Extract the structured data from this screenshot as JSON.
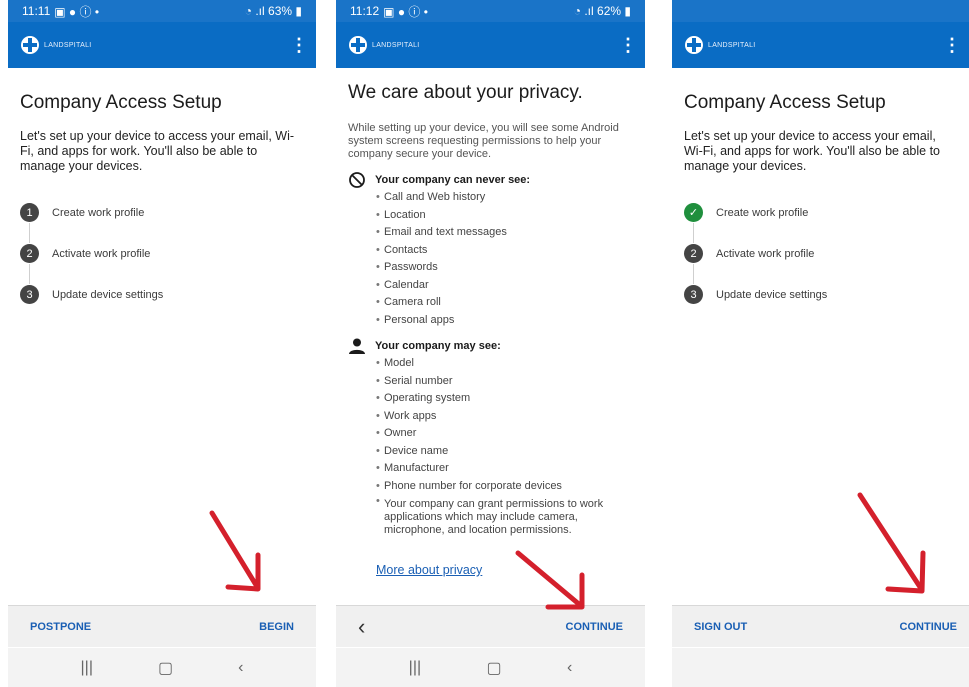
{
  "screens": [
    {
      "status": {
        "time": "11:11",
        "battery": "63%"
      },
      "app": {
        "logo_text": "LANDSPITALI"
      },
      "title": "Company Access Setup",
      "intro": "Let's set up your device to access your email, Wi-Fi, and apps for work. You'll also be able to manage your devices.",
      "steps": [
        {
          "num": "1",
          "label": "Create work profile",
          "done": false
        },
        {
          "num": "2",
          "label": "Activate work profile",
          "done": false
        },
        {
          "num": "3",
          "label": "Update device settings",
          "done": false
        }
      ],
      "footer": {
        "left": "POSTPONE",
        "right": "BEGIN"
      }
    },
    {
      "status": {
        "time": "11:12",
        "battery": "62%"
      },
      "app": {
        "logo_text": "LANDSPITALI"
      },
      "title": "We care about your privacy.",
      "intro": "While setting up your device, you will see some Android system screens requesting permissions to help your company secure your device.",
      "never_see": {
        "heading": "Your company can never see:",
        "items": [
          "Call and Web history",
          "Location",
          "Email and text messages",
          "Contacts",
          "Passwords",
          "Calendar",
          "Camera roll",
          "Personal apps"
        ]
      },
      "may_see": {
        "heading": "Your company may see:",
        "items": [
          "Model",
          "Serial number",
          "Operating system",
          "Work apps",
          "Owner",
          "Device name",
          "Manufacturer",
          "Phone number for corporate devices"
        ],
        "last_item": "Your company can grant permissions to work applications which may include camera, microphone, and location permissions."
      },
      "link": "More about privacy",
      "footer": {
        "back": "‹",
        "right": "CONTINUE"
      }
    },
    {
      "app": {
        "logo_text": "LANDSPITALI"
      },
      "title": "Company Access Setup",
      "intro": "Let's set up your device to access your email, Wi-Fi, and apps for work. You'll also be able to manage your devices.",
      "steps": [
        {
          "num": "✓",
          "label": "Create work profile",
          "done": true
        },
        {
          "num": "2",
          "label": "Activate work profile",
          "done": false
        },
        {
          "num": "3",
          "label": "Update device settings",
          "done": false
        }
      ],
      "footer": {
        "left": "SIGN OUT",
        "right": "CONTINUE"
      }
    }
  ],
  "colors": {
    "brand": "#0a6cc4",
    "link": "#1a5fb4",
    "annotation_arrow": "#d4202c",
    "done": "#1f8f3d"
  }
}
